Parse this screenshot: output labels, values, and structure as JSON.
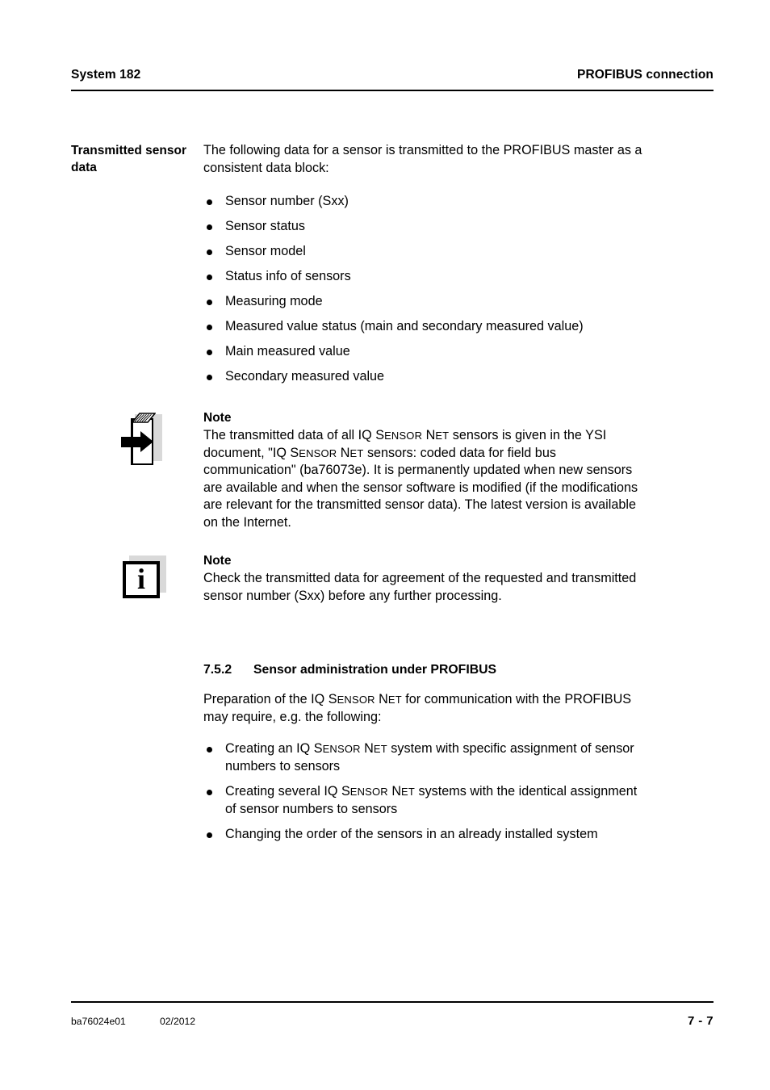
{
  "header": {
    "left": "System 182",
    "right": "PROFIBUS connection"
  },
  "section_transmitted": {
    "side_label": "Transmitted sensor data",
    "intro": "The following data for a sensor is transmitted to the PROFIBUS master as a consistent data block:",
    "bullets": [
      "Sensor number (Sxx)",
      "Sensor status",
      "Sensor model",
      "Status info of sensors",
      "Measuring mode",
      "Measured value status (main and secondary measured value)",
      "Main measured value",
      "Secondary measured value"
    ]
  },
  "note_book": {
    "icon": "book-arrow-icon",
    "title": "Note",
    "text_parts": {
      "p1": "The transmitted data of all IQ ",
      "sc1_lead": "S",
      "sc1_rest": "ENSOR",
      "sc2_lead": " N",
      "sc2_rest": "ET",
      "p2": " sensors is given in the YSI document, \"IQ ",
      "sc3_lead": "S",
      "sc3_rest": "ENSOR",
      "sc4_lead": " N",
      "sc4_rest": "ET",
      "p3": " sensors: coded data for field bus communication\" (ba76073e). It is permanently updated when new sensors are available and when the sensor software is modified (if the modifications are relevant for the transmitted sensor data). The latest version is available on the Internet."
    }
  },
  "note_info": {
    "icon": "info-icon",
    "icon_glyph": "i",
    "title": "Note",
    "text": "Check the transmitted data for agreement of the requested and transmitted sensor number (Sxx) before any further processing."
  },
  "section_admin": {
    "number": "7.5.2",
    "title": "Sensor administration under PROFIBUS",
    "intro_parts": {
      "p1": "Preparation of the IQ ",
      "sc1_lead": "S",
      "sc1_rest": "ENSOR",
      "sc2_lead": " N",
      "sc2_rest": "ET",
      "p2": " for communication with the PROFIBUS may require, e.g. the following:"
    },
    "bullets": [
      {
        "p1": "Creating an IQ ",
        "sc1_lead": "S",
        "sc1_rest": "ENSOR",
        "sc2_lead": " N",
        "sc2_rest": "ET",
        "p2": " system with specific assignment of sensor numbers to sensors"
      },
      {
        "p1": "Creating several IQ ",
        "sc1_lead": "S",
        "sc1_rest": "ENSOR",
        "sc2_lead": " N",
        "sc2_rest": "ET",
        "p2": " systems with the identical assignment of sensor numbers to sensors"
      },
      {
        "p1": "Changing the order of the sensors in an already installed system",
        "sc1_lead": "",
        "sc1_rest": "",
        "sc2_lead": "",
        "sc2_rest": "",
        "p2": ""
      }
    ]
  },
  "footer": {
    "doc_id": "ba76024e01",
    "doc_date": "02/2012",
    "page_number": "7 - 7"
  },
  "colors": {
    "text": "#000000",
    "rule": "#000000",
    "icon_shadow": "#d9d9d9",
    "background": "#ffffff"
  }
}
